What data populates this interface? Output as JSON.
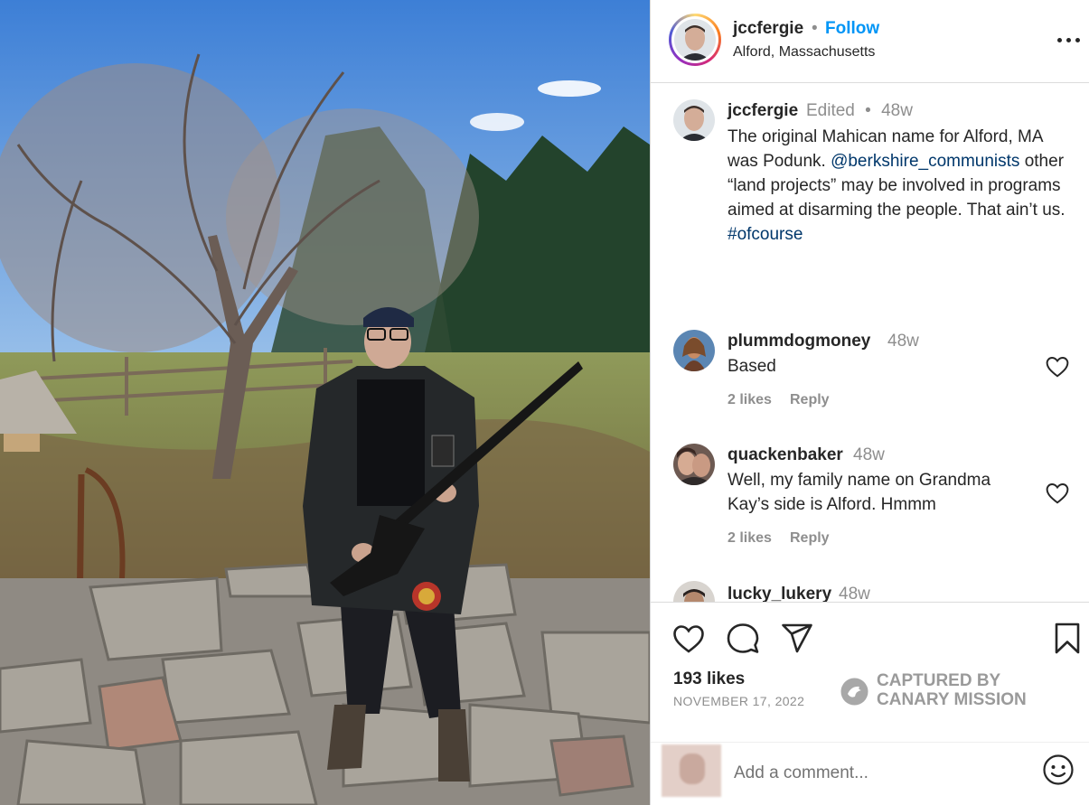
{
  "header": {
    "username": "jccfergie",
    "separator": "•",
    "follow_label": "Follow",
    "location": "Alford, Massachusetts",
    "more_icon": "more-horizontal-icon"
  },
  "caption": {
    "username": "jccfergie",
    "edited": "Edited",
    "separator": "•",
    "time": "48w",
    "text_part1": "The original Mahican name for Alford, MA was Podunk. ",
    "mention": "@berkshire_communists",
    "text_part2": " other “land projects” may be involved in programs aimed at disarming the people. That ain’t us. ",
    "hashtag": "#ofcourse"
  },
  "comments": [
    {
      "username": "plummdogmoney",
      "time": "48w",
      "text": "Based",
      "likes": "2 likes",
      "reply": "Reply"
    },
    {
      "username": "quackenbaker",
      "time": "48w",
      "text": "Well, my family name on Grandma Kay’s side is Alford. Hmmm",
      "likes": "2 likes",
      "reply": "Reply"
    },
    {
      "username": "lucky_lukery",
      "time": "48w"
    }
  ],
  "actions": {
    "likes": "193 likes",
    "date": "NOVEMBER 17, 2022",
    "icons": [
      "heart-icon",
      "comment-icon",
      "share-icon",
      "bookmark-icon"
    ]
  },
  "watermark": {
    "line1": "CAPTURED BY",
    "line2": "CANARY MISSION"
  },
  "add_comment": {
    "placeholder": "Add a comment..."
  },
  "colors": {
    "follow": "#0095f6",
    "link": "#00376b",
    "muted": "#8e8e8e",
    "text": "#262626"
  }
}
